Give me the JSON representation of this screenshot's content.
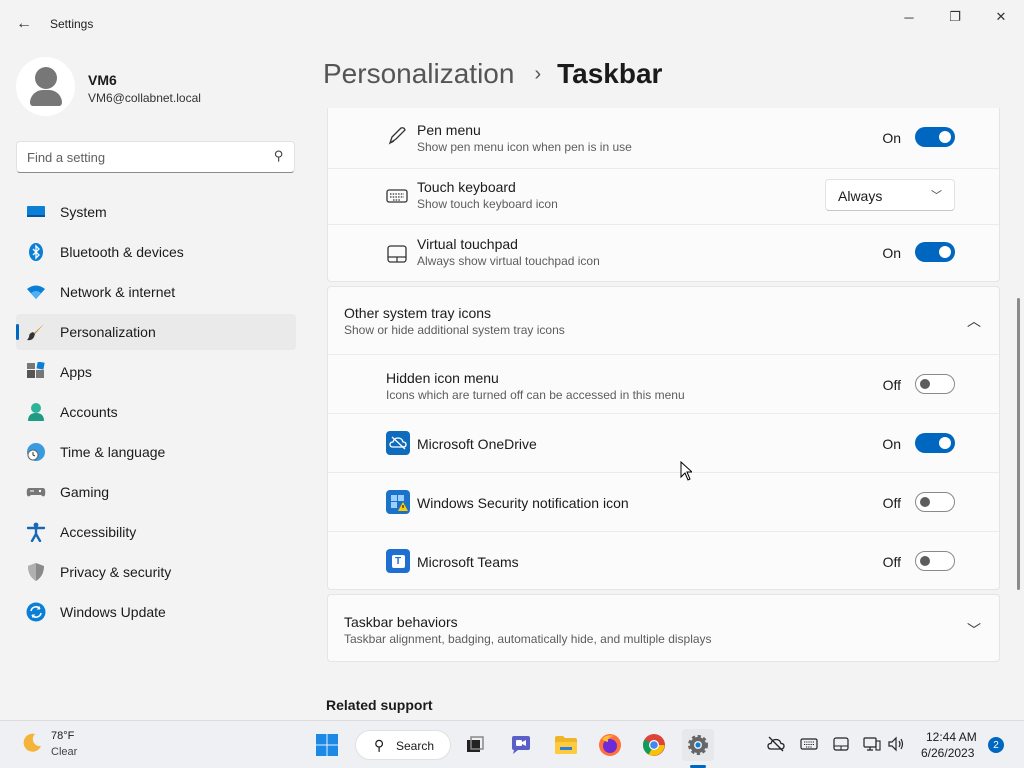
{
  "window": {
    "title": "Settings",
    "back_glyph": "←",
    "minimize_glyph": "─",
    "maximize_glyph": "❐",
    "close_glyph": "✕"
  },
  "user": {
    "name": "VM6",
    "email": "VM6@collabnet.local"
  },
  "search": {
    "placeholder": "Find a setting"
  },
  "nav": {
    "items": [
      {
        "label": "System",
        "icon": "system-icon",
        "active": false
      },
      {
        "label": "Bluetooth & devices",
        "icon": "bluetooth-icon",
        "active": false
      },
      {
        "label": "Network & internet",
        "icon": "wifi-icon",
        "active": false
      },
      {
        "label": "Personalization",
        "icon": "brush-icon",
        "active": true
      },
      {
        "label": "Apps",
        "icon": "apps-icon",
        "active": false
      },
      {
        "label": "Accounts",
        "icon": "accounts-icon",
        "active": false
      },
      {
        "label": "Time & language",
        "icon": "clock-globe-icon",
        "active": false
      },
      {
        "label": "Gaming",
        "icon": "gamepad-icon",
        "active": false
      },
      {
        "label": "Accessibility",
        "icon": "accessibility-icon",
        "active": false
      },
      {
        "label": "Privacy & security",
        "icon": "shield-icon",
        "active": false
      },
      {
        "label": "Windows Update",
        "icon": "update-icon",
        "active": false
      }
    ]
  },
  "header": {
    "parent": "Personalization",
    "separator": "›",
    "current": "Taskbar"
  },
  "corner_icons": {
    "pen_menu": {
      "title": "Pen menu",
      "subtitle": "Show pen menu icon when pen is in use",
      "state": "On",
      "enabled": true
    },
    "touch_keyboard": {
      "title": "Touch keyboard",
      "subtitle": "Show touch keyboard icon",
      "value": "Always"
    },
    "virtual_touchpad": {
      "title": "Virtual touchpad",
      "subtitle": "Always show virtual touchpad icon",
      "state": "On",
      "enabled": true
    }
  },
  "other_tray": {
    "title": "Other system tray icons",
    "subtitle": "Show or hide additional system tray icons",
    "expanded": true,
    "items": [
      {
        "title": "Hidden icon menu",
        "subtitle": "Icons which are turned off can be accessed in this menu",
        "state": "Off",
        "enabled": false
      },
      {
        "title": "Microsoft OneDrive",
        "icon": "onedrive-icon",
        "state": "On",
        "enabled": true
      },
      {
        "title": "Windows Security notification icon",
        "icon": "windows-security-icon",
        "state": "Off",
        "enabled": false
      },
      {
        "title": "Microsoft Teams",
        "icon": "teams-icon",
        "icon_letter": "T",
        "state": "Off",
        "enabled": false
      }
    ]
  },
  "taskbar_behaviors": {
    "title": "Taskbar behaviors",
    "subtitle": "Taskbar alignment, badging, automatically hide, and multiple displays",
    "expanded": false
  },
  "related_support": "Related support",
  "taskbar": {
    "weather": {
      "temp": "78°F",
      "condition": "Clear"
    },
    "search_label": "Search",
    "clock_time": "12:44 AM",
    "clock_date": "6/26/2023",
    "notification_count": "2",
    "colors": {
      "accent": "#0067c0"
    }
  }
}
